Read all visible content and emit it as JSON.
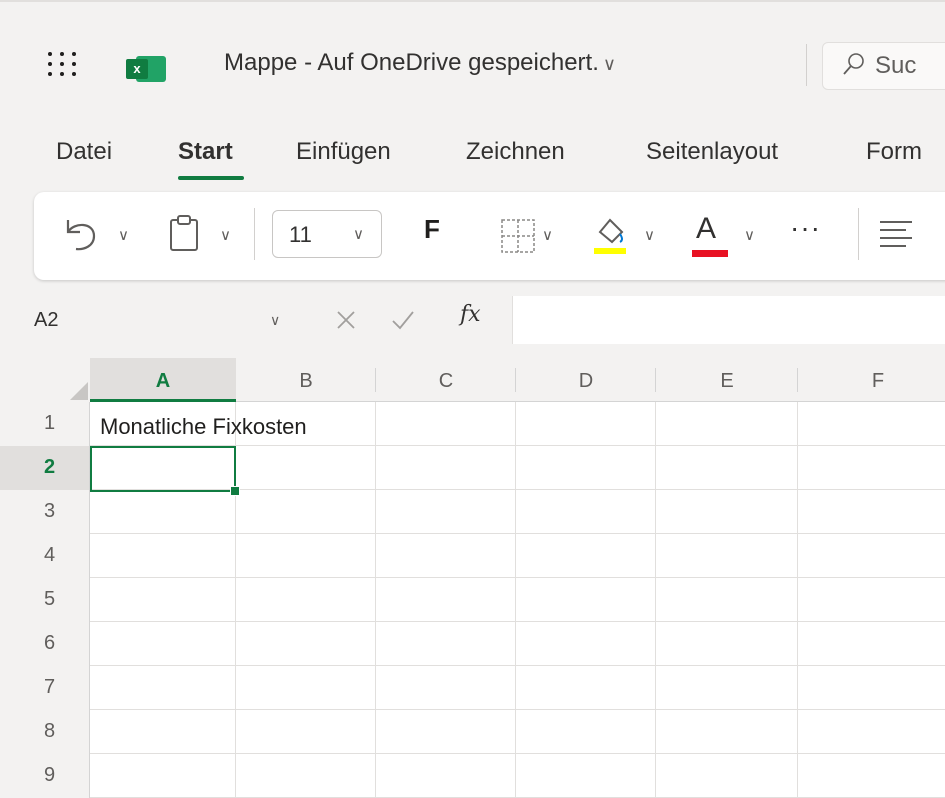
{
  "header": {
    "doc_name": "Mappe",
    "doc_separator": "-",
    "save_status": "Auf OneDrive gespeichert.",
    "search_placeholder": "Suc"
  },
  "ribbon_tabs": [
    "Datei",
    "Start",
    "Einfügen",
    "Zeichnen",
    "Seitenlayout",
    "Form"
  ],
  "ribbon_tabs_active": "Start",
  "toolbar": {
    "font_size": "11",
    "bold_label": "F",
    "font_color_label": "A",
    "more_label": "···",
    "fill_color": "#ffff00",
    "font_color": "#e81123",
    "icons": [
      "undo-icon",
      "paste-icon",
      "borders-icon",
      "fill-color-icon",
      "font-color-icon",
      "align-icon"
    ]
  },
  "formula_bar": {
    "name_box": "A2",
    "fx_label": "fx",
    "formula_value": ""
  },
  "sheet": {
    "columns": [
      "A",
      "B",
      "C",
      "D",
      "E",
      "F"
    ],
    "rows": [
      "1",
      "2",
      "3",
      "4",
      "5",
      "6",
      "7",
      "8",
      "9"
    ],
    "active_cell": "A2",
    "cells": {
      "A1": "Monatliche Fixkosten"
    }
  },
  "colors": {
    "accent": "#107c41",
    "chrome": "#f3f2f1"
  }
}
